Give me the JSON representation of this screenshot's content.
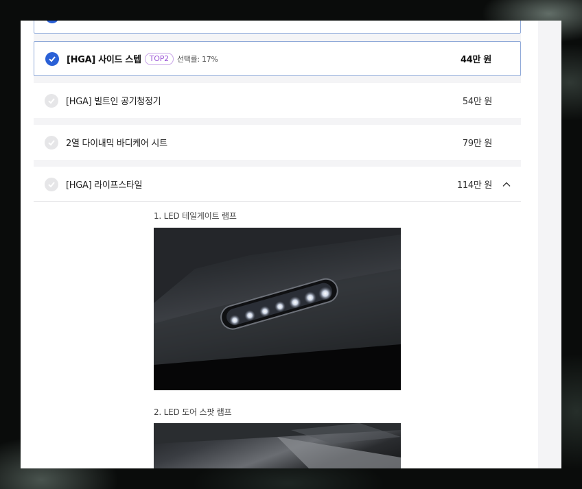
{
  "options": [
    {
      "name": "",
      "price": "",
      "selected": true,
      "badge": "",
      "rate": ""
    },
    {
      "name": "[HGA] 사이드 스텝",
      "badge": "TOP2",
      "rate": "선택률: 17%",
      "price": "44만 원",
      "selected": true
    },
    {
      "name": "[HGA] 빌트인 공기청정기",
      "price": "54만 원",
      "selected": false
    },
    {
      "name": "2열 다이내믹 바디케어 시트",
      "price": "79만 원",
      "selected": false
    },
    {
      "name": "[HGA] 라이프스타일",
      "price": "114만 원",
      "selected": false,
      "expanded": true
    }
  ],
  "lifestyle_details": [
    {
      "title": "1. LED 테일게이트 램프",
      "image": "led-tailgate-lamp-photo"
    },
    {
      "title": "2. LED 도어 스팟 램프",
      "image": "led-door-spot-lamp-photo"
    }
  ],
  "colors": {
    "accent": "#2a60d6",
    "badge": "#9b55d6",
    "selected_border": "#8fa9d8"
  }
}
